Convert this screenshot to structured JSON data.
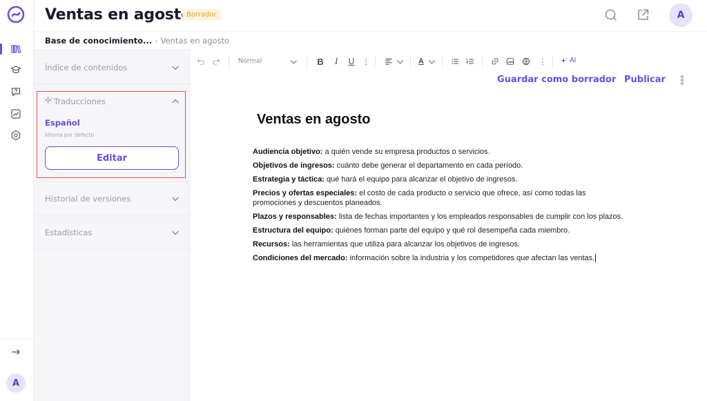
{
  "header": {
    "title": "Ventas en agosto",
    "status": "Borrador",
    "avatar": "A"
  },
  "breadcrumb": {
    "root": "Base de conocimiento...",
    "current": "Ventas en agosto"
  },
  "rail": {
    "avatar": "A"
  },
  "panel": {
    "sections": {
      "toc": "Índice de contenidos",
      "translations": "Traducciones",
      "history": "Historial de versiones",
      "stats": "Estadísticas"
    },
    "language": "Español",
    "language_note": "Idioma por defecto",
    "edit_label": "Editar"
  },
  "toolbar": {
    "style": "Normal",
    "ai": "AI",
    "save_draft": "Guardar como borrador",
    "publish": "Publicar"
  },
  "document": {
    "title": "Ventas en agosto",
    "items": [
      {
        "term": "Audiencia objetivo:",
        "text": " a quién vende su empresa productos o servicios."
      },
      {
        "term": "Objetivos de ingresos:",
        "text": " cuánto debe generar el departamento en cada período."
      },
      {
        "term": "Estrategia y táctica:",
        "text": " qué hará el equipo para alcanzar el objetivo de ingresos."
      },
      {
        "term": "Precios y ofertas especiales:",
        "text": " el costo de cada producto o servicio que ofrece, así como todas las promociones y descuentos planeados."
      },
      {
        "term": "Plazos y responsables:",
        "text": " lista de fechas importantes y los empleados responsables de cumplir con los plazos."
      },
      {
        "term": "Estructura del equipo:",
        "text": " quiénes forman parte del equipo y qué rol desempeña cada miembro."
      },
      {
        "term": "Recursos:",
        "text": " las herramientas que utiliza para alcanzar los objetivos de ingresos."
      },
      {
        "term": "Condiciones del mercado:",
        "text": " información sobre la industria y los competidores que afectan las ventas."
      }
    ]
  },
  "colors": {
    "accent": "#6a4ee0",
    "highlight_border": "#e8503f",
    "badge_text": "#e0a230"
  }
}
